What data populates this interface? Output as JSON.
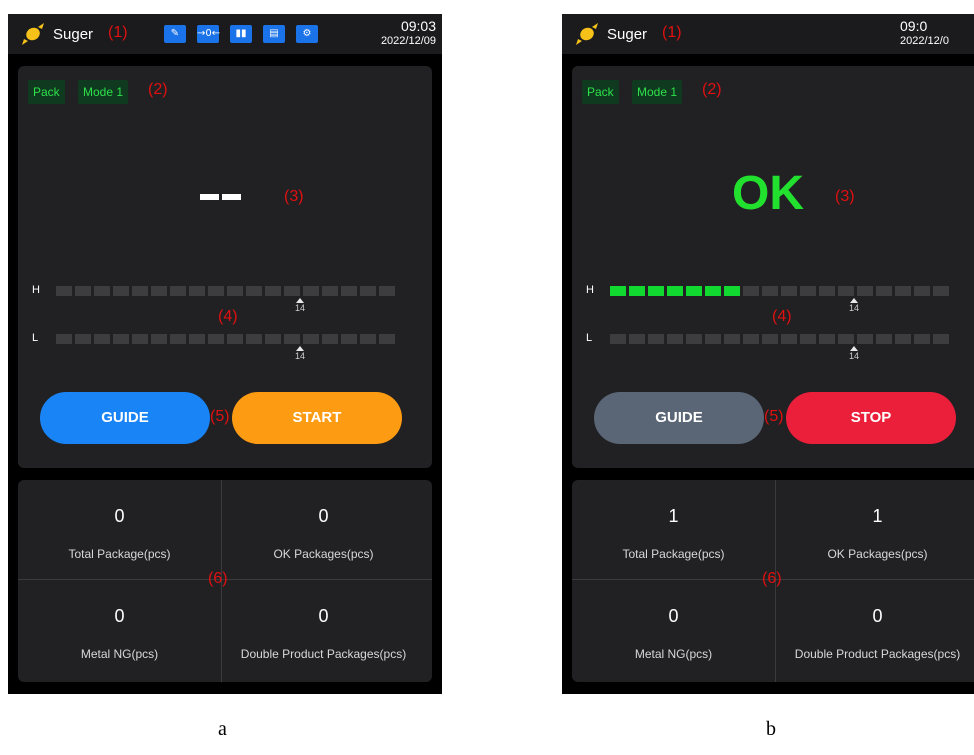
{
  "annotations": {
    "a1": "(1)",
    "a2": "(2)",
    "a3": "(3)",
    "a4": "(4)",
    "a5": "(5)",
    "a6": "(6)"
  },
  "colors": {
    "accent_blue": "#1984f6",
    "start_orange": "#fd9b12",
    "stop_red": "#ec1f3a",
    "ok_green": "#22e02e",
    "annotation_red": "#e01010"
  },
  "panel_a": {
    "app_name": "Suger",
    "toolbar_icons": [
      "pencil-icon",
      "zero-tracking-icon",
      "bar-chart-icon",
      "report-icon",
      "gear-icon"
    ],
    "time": "09:03",
    "date": "2022/12/09",
    "chip_pack": "Pack",
    "chip_mode": "Mode 1",
    "h_marker": "14",
    "l_marker": "14",
    "h_level": 0,
    "l_level": 0,
    "guide_label": "GUIDE",
    "action_label": "START",
    "stats": [
      {
        "value": "0",
        "label": "Total Package(pcs)"
      },
      {
        "value": "0",
        "label": "OK Packages(pcs)"
      },
      {
        "value": "0",
        "label": "Metal NG(pcs)"
      },
      {
        "value": "0",
        "label": "Double Product Packages(pcs)"
      }
    ],
    "caption": "a"
  },
  "panel_b": {
    "app_name": "Suger",
    "time": "09:0",
    "date": "2022/12/0",
    "chip_pack": "Pack",
    "chip_mode": "Mode 1",
    "status": "OK",
    "h_marker": "14",
    "l_marker": "14",
    "h_level": 7,
    "l_level": 0,
    "guide_label": "GUIDE",
    "action_label": "STOP",
    "stats": [
      {
        "value": "1",
        "label": "Total Package(pcs)"
      },
      {
        "value": "1",
        "label": "OK Packages(pcs)"
      },
      {
        "value": "0",
        "label": "Metal NG(pcs)"
      },
      {
        "value": "0",
        "label": "Double Product Packages(pcs)"
      }
    ],
    "caption": "b"
  }
}
